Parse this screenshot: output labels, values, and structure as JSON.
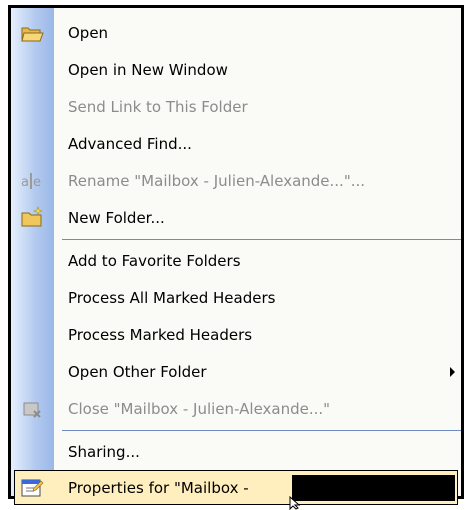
{
  "menu": {
    "items": [
      {
        "label": "Open",
        "icon": "open-folder-icon",
        "disabled": false
      },
      {
        "label": "Open in New Window",
        "disabled": false
      },
      {
        "label": "Send Link to This Folder",
        "disabled": true
      },
      {
        "label": "Advanced Find...",
        "disabled": false
      },
      {
        "label": "Rename \"Mailbox - Julien-Alexande...\"...",
        "icon": "rename-icon",
        "disabled": true
      },
      {
        "label": "New Folder...",
        "icon": "new-folder-icon",
        "disabled": false
      },
      {
        "label": "Add to Favorite Folders",
        "disabled": false
      },
      {
        "label": "Process All Marked Headers",
        "disabled": false
      },
      {
        "label": "Process Marked Headers",
        "disabled": false
      },
      {
        "label": "Open Other Folder",
        "disabled": false,
        "submenu": true
      },
      {
        "label": "Close \"Mailbox - Julien-Alexande...\"",
        "icon": "close-folder-icon",
        "disabled": true
      },
      {
        "label": "Sharing...",
        "disabled": false
      },
      {
        "label": "Properties for \"Mailbox -",
        "icon": "properties-icon",
        "disabled": false,
        "selected": true
      }
    ]
  },
  "colors": {
    "accent_selected": "#ffeebe",
    "separator": "#6e8bc6",
    "disabled_text": "#8c8c8c"
  }
}
